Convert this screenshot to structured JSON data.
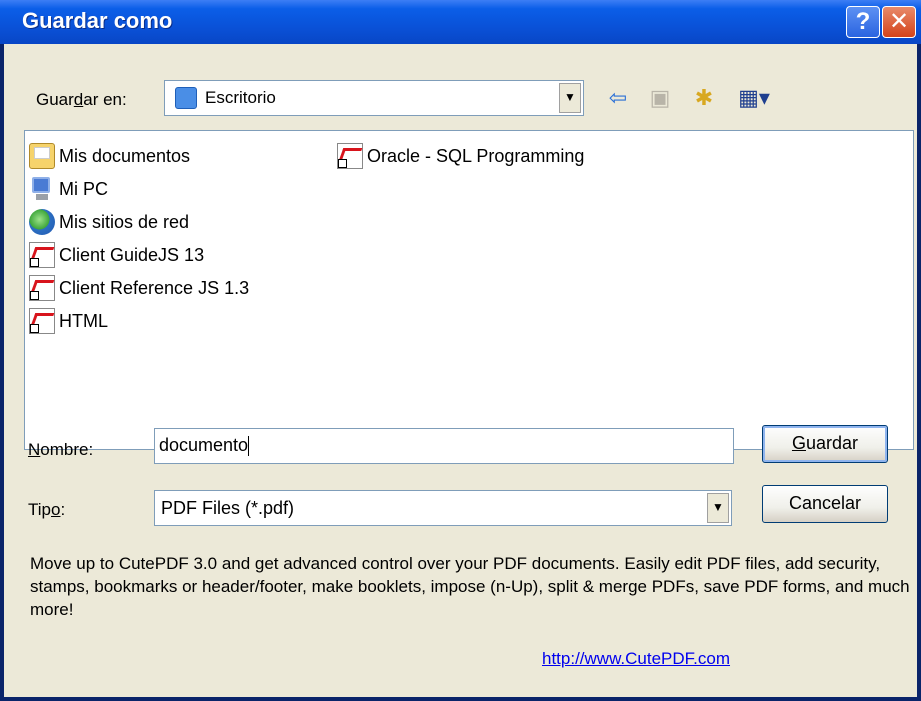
{
  "window": {
    "title": "Guardar como",
    "help_glyph": "?",
    "close_glyph": "✕"
  },
  "toolbar": {
    "save_in_label_pre": "Guar",
    "save_in_label_acc": "d",
    "save_in_label_post": "ar en:",
    "location_value": "Escritorio",
    "location_icon": "desktop-icon",
    "back_glyph": "⇦",
    "up_glyph": "▣",
    "newfolder_glyph": "✱",
    "views_glyph": "▦▾"
  },
  "file_list": {
    "items": [
      {
        "label": "Mis documentos",
        "icon": "my-documents-icon"
      },
      {
        "label": "Mi PC",
        "icon": "my-computer-icon"
      },
      {
        "label": "Mis sitios de red",
        "icon": "network-places-icon"
      },
      {
        "label": "Client GuideJS 13",
        "icon": "pdf-shortcut-icon"
      },
      {
        "label": "Client Reference JS 1.3",
        "icon": "pdf-shortcut-icon"
      },
      {
        "label": "HTML",
        "icon": "pdf-shortcut-icon"
      },
      {
        "label": "Oracle - SQL Programming",
        "icon": "pdf-shortcut-icon"
      }
    ]
  },
  "form": {
    "name_label_acc": "N",
    "name_label_rest": "ombre:",
    "name_value": "documento",
    "type_label_pre": "Tip",
    "type_label_acc": "o",
    "type_label_post": ":",
    "type_value": "PDF Files (*.pdf)",
    "save_button_acc": "G",
    "save_button_rest": "uardar",
    "cancel_button": "Cancelar"
  },
  "promo": {
    "text": "Move up to CutePDF 3.0 and get advanced control over your PDF documents. Easily edit PDF files, add security, stamps, bookmarks or header/footer, make booklets, impose (n-Up), split & merge PDFs, save PDF forms, and much more!",
    "link": "http://www.CutePDF.com"
  },
  "colors": {
    "titlebar": "#0a52d8",
    "dialog_bg": "#ece9d8",
    "close_button": "#d4431a",
    "link": "#0000ee"
  }
}
